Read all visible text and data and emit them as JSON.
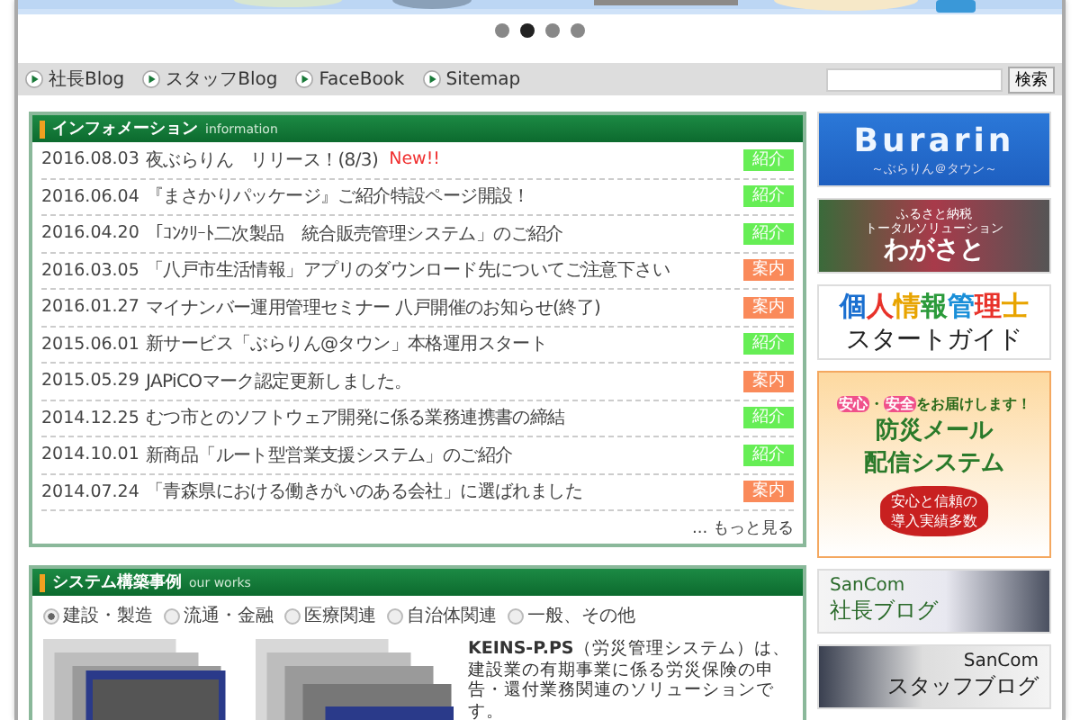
{
  "slider_dots": [
    {
      "selected": false
    },
    {
      "selected": true
    },
    {
      "selected": false
    },
    {
      "selected": false
    }
  ],
  "nav": {
    "links": [
      "社長Blog",
      "スタッフBlog",
      "FaceBook",
      "Sitemap"
    ],
    "search_button": "検索"
  },
  "information": {
    "title": "インフォメーション",
    "subtitle": "information",
    "rows": [
      {
        "date": "2016.08.03",
        "text": "夜ぶらりん　リリース！(8/3)",
        "new": "New!!",
        "tag": {
          "label": "紹介",
          "color": "#66ee55"
        }
      },
      {
        "date": "2016.06.04",
        "text": "『まさかりパッケージ』ご紹介特設ページ開設！",
        "tag": {
          "label": "紹介",
          "color": "#66ee55"
        }
      },
      {
        "date": "2016.04.20",
        "text": "「ｺﾝｸﾘｰﾄ二次製品　統合販売管理システム」のご紹介",
        "tag": {
          "label": "紹介",
          "color": "#66ee55"
        }
      },
      {
        "date": "2016.03.05",
        "text": "「八戸市生活情報」アプリのダウンロード先についてご注意下さい",
        "tag": {
          "label": "案内",
          "color": "#fa8a5a"
        }
      },
      {
        "date": "2016.01.27",
        "text": "マイナンバー運用管理セミナー 八戸開催のお知らせ(終了)",
        "tag": {
          "label": "案内",
          "color": "#fa8a5a"
        }
      },
      {
        "date": "2015.06.01",
        "text": "新サービス「ぶらりん@タウン」本格運用スタート",
        "tag": {
          "label": "紹介",
          "color": "#66ee55"
        }
      },
      {
        "date": "2015.05.29",
        "text": "JAPiCOマーク認定更新しました。",
        "tag": {
          "label": "案内",
          "color": "#fa8a5a"
        }
      },
      {
        "date": "2014.12.25",
        "text": "むつ市とのソフトウェア開発に係る業務連携書の締結",
        "tag": {
          "label": "紹介",
          "color": "#66ee55"
        }
      },
      {
        "date": "2014.10.01",
        "text": "新商品「ルート型営業支援システム」のご紹介",
        "tag": {
          "label": "紹介",
          "color": "#66ee55"
        }
      },
      {
        "date": "2014.07.24",
        "text": "「青森県における働きがいのある会社」に選ばれました",
        "tag": {
          "label": "案内",
          "color": "#fa8a5a"
        }
      }
    ],
    "more_link": "... もっと見る"
  },
  "works": {
    "title": "システム構築事例",
    "subtitle": "our works",
    "categories": [
      {
        "label": "建設・製造",
        "selected": true
      },
      {
        "label": "流通・金融",
        "selected": false
      },
      {
        "label": "医療関連",
        "selected": false
      },
      {
        "label": "自治体関連",
        "selected": false
      },
      {
        "label": "一般、その他",
        "selected": false
      }
    ],
    "description": "**KEINS-P.PS**（労災管理システム）は、建設業の有期事業に係る労災保険の申告・還付業務関連のソリューションです。"
  },
  "banners": [
    {
      "kind": "burarin",
      "title": "Burarin",
      "subtitle": "～ぶらりん＠タウン～"
    },
    {
      "kind": "wagasato",
      "lines": [
        "ふるさと納税",
        "トータルソリューション"
      ],
      "title": "わがさと"
    },
    {
      "kind": "guide",
      "title": "個人情報管理士",
      "subtitle": "スタートガイド"
    },
    {
      "kind": "bousai",
      "tagline": [
        {
          "kind": "pill",
          "text": "安心"
        },
        {
          "kind": "plain",
          "text": "・"
        },
        {
          "kind": "pill",
          "text": "安全"
        },
        {
          "kind": "plain",
          "text": "をお届けします！"
        }
      ],
      "title": "防災メール",
      "title2": "配信システム",
      "burst": [
        "安心と信頼の",
        "導入実績多数"
      ]
    },
    {
      "kind": "blog",
      "brand": "SanCom",
      "title": "社長ブログ"
    },
    {
      "kind": "blog-right",
      "brand": "SanCom",
      "title": "スタッフブログ"
    }
  ]
}
